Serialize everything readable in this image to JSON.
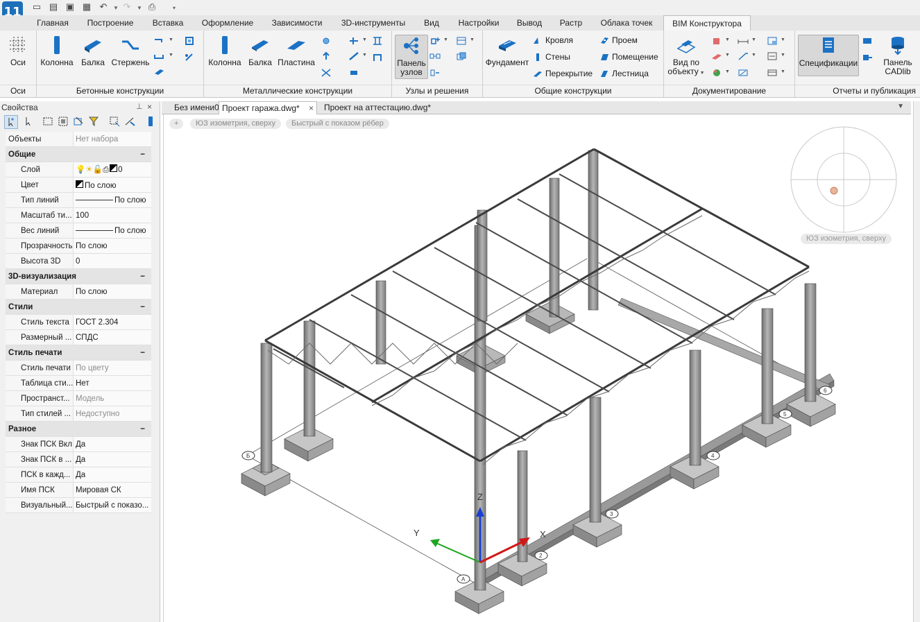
{
  "app": {
    "logo_text": "11"
  },
  "quick_access": [
    {
      "name": "new-file-icon",
      "glyph": "🗋"
    },
    {
      "name": "open-folder-icon",
      "glyph": "📂"
    },
    {
      "name": "save-icon",
      "glyph": "💾"
    },
    {
      "name": "save-all-icon",
      "glyph": "🖫"
    },
    {
      "name": "undo-icon",
      "glyph": "↶"
    },
    {
      "name": "redo-icon",
      "glyph": "↷"
    },
    {
      "name": "print-icon",
      "glyph": "🖶"
    }
  ],
  "tabs": [
    "Главная",
    "Построение",
    "Вставка",
    "Оформление",
    "Зависимости",
    "3D-инструменты",
    "Вид",
    "Настройки",
    "Вывод",
    "Растр",
    "Облака точек",
    "BIM Конструктора"
  ],
  "active_tab": "BIM Конструктора",
  "ribbon": {
    "axes": {
      "btn": "Оси",
      "title": "Оси"
    },
    "concrete": {
      "title": "Бетонные конструкции",
      "column": "Колонна",
      "beam": "Балка",
      "rod": "Стержень"
    },
    "metal": {
      "title": "Металлические конструкции",
      "column": "Колонна",
      "beam": "Балка",
      "plate": "Пластина"
    },
    "nodes": {
      "title": "Узлы и решения",
      "panel_line1": "Панель",
      "panel_line2": "узлов"
    },
    "general": {
      "title": "Общие конструкции",
      "foundation": "Фундамент",
      "roof": "Кровля",
      "walls": "Стены",
      "slab": "Перекрытие",
      "opening": "Проем",
      "room": "Помещение",
      "stair": "Лестница"
    },
    "docs": {
      "title": "Документирование",
      "view_line1": "Вид по",
      "view_line2": "объекту"
    },
    "reports": {
      "title": "Отчеты и публикация",
      "spec": "Спецификации",
      "cadlib_line1": "Панель",
      "cadlib_line2": "CADlib"
    }
  },
  "properties": {
    "title": "Свойства",
    "objects_key": "Объекты",
    "objects_val": "Нет набора",
    "sections": [
      {
        "name": "Общие",
        "rows": [
          {
            "k": "Слой",
            "v": "0"
          },
          {
            "k": "Цвет",
            "v": "По слою"
          },
          {
            "k": "Тип линий",
            "v": "По слою"
          },
          {
            "k": "Масштаб ти...",
            "v": "100"
          },
          {
            "k": "Вес линий",
            "v": "По слою"
          },
          {
            "k": "Прозрачность",
            "v": "По слою"
          },
          {
            "k": "Высота 3D",
            "v": "0"
          }
        ]
      },
      {
        "name": "3D-визуализация",
        "rows": [
          {
            "k": "Материал",
            "v": "По слою"
          }
        ]
      },
      {
        "name": "Стили",
        "rows": [
          {
            "k": "Стиль текста",
            "v": "ГОСТ 2.304"
          },
          {
            "k": "Размерный ...",
            "v": "СПДС"
          }
        ]
      },
      {
        "name": "Стиль печати",
        "rows": [
          {
            "k": "Стиль печати",
            "v": "По цвету"
          },
          {
            "k": "Таблица сти...",
            "v": "Нет"
          },
          {
            "k": "Пространст...",
            "v": "Модель"
          },
          {
            "k": "Тип стилей ...",
            "v": "Недоступно"
          }
        ]
      },
      {
        "name": "Разное",
        "rows": [
          {
            "k": "Знак ПСК Вкл",
            "v": "Да"
          },
          {
            "k": "Знак ПСК в ...",
            "v": "Да"
          },
          {
            "k": "ПСК в кажд...",
            "v": "Да"
          },
          {
            "k": "Имя ПСК",
            "v": "Мировая СК"
          },
          {
            "k": "Визуальный...",
            "v": "Быстрый с показо..."
          }
        ]
      }
    ]
  },
  "doc_tabs": [
    "Без имени0",
    "Проект гаража.dwg*",
    "Проект на аттестацию.dwg*"
  ],
  "active_doc": "Проект гаража.dwg*",
  "viewport": {
    "plus": "+",
    "view_label": "ЮЗ изометрия, сверху",
    "style_label": "Быстрый с показом рёбер",
    "compass_label": "ЮЗ изометрия, сверху",
    "ucs_z": "Z",
    "ucs_y": "Y",
    "ucs_x": "X",
    "grid_labels": [
      "А",
      "Б",
      "2",
      "3",
      "4",
      "5",
      "6",
      "5"
    ]
  },
  "colors": {
    "accent": "#1d6fb8",
    "ucs_x": "#d01818",
    "ucs_y": "#1fa51f",
    "ucs_z": "#1a3fd4",
    "steel": "#8a8a8a"
  }
}
